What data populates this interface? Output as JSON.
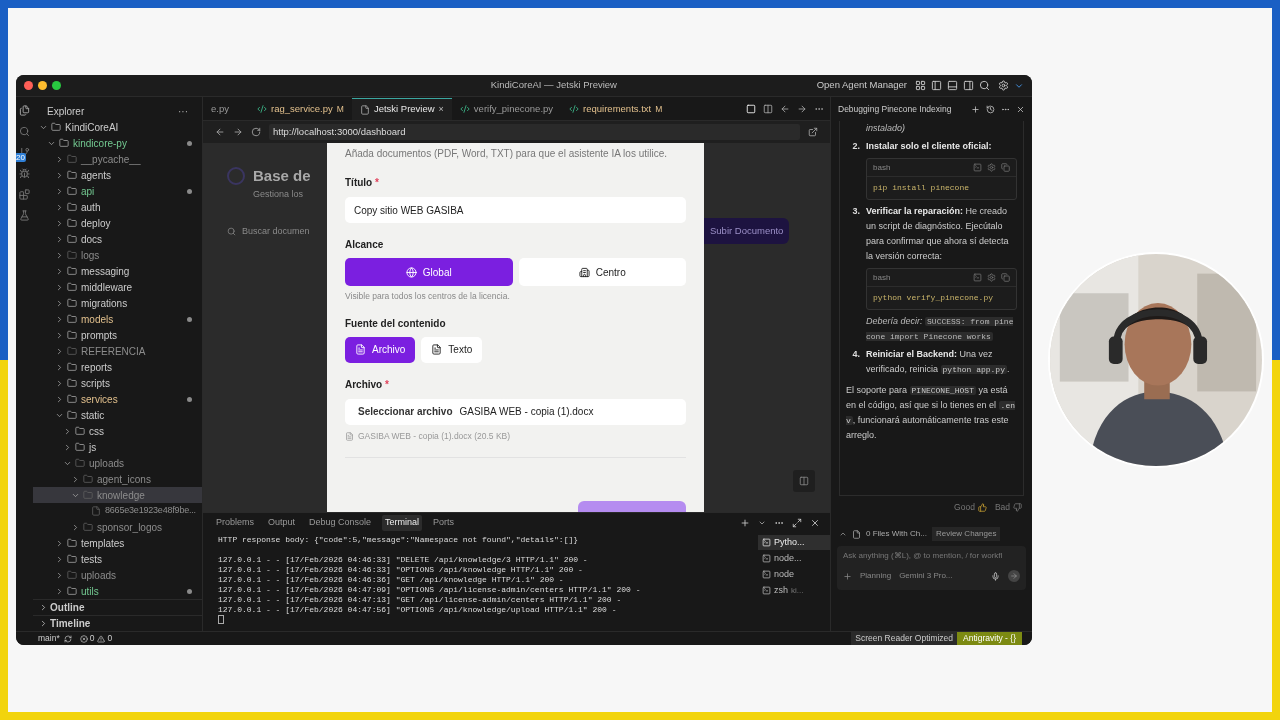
{
  "window": {
    "title": "KindiCoreAI — Jetski Preview",
    "agent_manager": "Open Agent Manager",
    "activity_badge": "20"
  },
  "explorer": {
    "title": "Explorer",
    "menu": "···",
    "tree": [
      {
        "label": "KindiCoreAI",
        "kind": "folder",
        "expanded": true,
        "untracked": false,
        "modified": false,
        "ignored": false,
        "selected": false,
        "children": [
          {
            "label": "kindicore-py",
            "kind": "folder",
            "expanded": true,
            "untracked": true,
            "modified": true,
            "ignored": false,
            "selected": false,
            "children": [
              {
                "label": "__pycache__",
                "kind": "folder",
                "expanded": false,
                "untracked": false,
                "modified": false,
                "ignored": true,
                "selected": false
              },
              {
                "label": "agents",
                "kind": "folder",
                "expanded": false,
                "untracked": false,
                "modified": false,
                "ignored": false,
                "selected": false
              },
              {
                "label": "api",
                "kind": "folder",
                "expanded": false,
                "untracked": true,
                "modified": true,
                "ignored": false,
                "selected": false
              },
              {
                "label": "auth",
                "kind": "folder",
                "expanded": false,
                "untracked": false,
                "modified": false,
                "ignored": false,
                "selected": false
              },
              {
                "label": "deploy",
                "kind": "folder",
                "expanded": false,
                "untracked": false,
                "modified": false,
                "ignored": false,
                "selected": false
              },
              {
                "label": "docs",
                "kind": "folder",
                "expanded": false,
                "untracked": false,
                "modified": false,
                "ignored": false,
                "selected": false
              },
              {
                "label": "logs",
                "kind": "folder",
                "expanded": false,
                "untracked": false,
                "modified": false,
                "ignored": true,
                "selected": false
              },
              {
                "label": "messaging",
                "kind": "folder",
                "expanded": false,
                "untracked": false,
                "modified": false,
                "ignored": false,
                "selected": false
              },
              {
                "label": "middleware",
                "kind": "folder",
                "expanded": false,
                "untracked": false,
                "modified": false,
                "ignored": false,
                "selected": false
              },
              {
                "label": "migrations",
                "kind": "folder",
                "expanded": false,
                "untracked": false,
                "modified": false,
                "ignored": false,
                "selected": false
              },
              {
                "label": "models",
                "kind": "folder",
                "expanded": false,
                "untracked": false,
                "modified": true,
                "ignored": false,
                "selected": false
              },
              {
                "label": "prompts",
                "kind": "folder",
                "expanded": false,
                "untracked": false,
                "modified": false,
                "ignored": false,
                "selected": false
              },
              {
                "label": "REFERENCIA",
                "kind": "folder",
                "expanded": false,
                "untracked": false,
                "modified": false,
                "ignored": true,
                "selected": false
              },
              {
                "label": "reports",
                "kind": "folder",
                "expanded": false,
                "untracked": false,
                "modified": false,
                "ignored": false,
                "selected": false
              },
              {
                "label": "scripts",
                "kind": "folder",
                "expanded": false,
                "untracked": false,
                "modified": false,
                "ignored": false,
                "selected": false
              },
              {
                "label": "services",
                "kind": "folder",
                "expanded": false,
                "untracked": false,
                "modified": true,
                "ignored": false,
                "selected": false
              },
              {
                "label": "static",
                "kind": "folder",
                "expanded": true,
                "untracked": false,
                "modified": false,
                "ignored": false,
                "selected": false,
                "children": [
                  {
                    "label": "css",
                    "kind": "folder",
                    "expanded": false,
                    "untracked": false,
                    "modified": false,
                    "ignored": false,
                    "selected": false
                  },
                  {
                    "label": "js",
                    "kind": "folder",
                    "expanded": false,
                    "untracked": false,
                    "modified": false,
                    "ignored": false,
                    "selected": false
                  },
                  {
                    "label": "uploads",
                    "kind": "folder",
                    "expanded": true,
                    "untracked": false,
                    "modified": false,
                    "ignored": true,
                    "selected": false,
                    "children": [
                      {
                        "label": "agent_icons",
                        "kind": "folder",
                        "expanded": false,
                        "untracked": false,
                        "modified": false,
                        "ignored": true,
                        "selected": false
                      },
                      {
                        "label": "knowledge",
                        "kind": "folder",
                        "expanded": true,
                        "untracked": false,
                        "modified": false,
                        "ignored": true,
                        "selected": true,
                        "children": [
                          {
                            "label": "8665e3e1923e48f9be...",
                            "kind": "file",
                            "untracked": false,
                            "modified": false,
                            "ignored": true,
                            "selected": false
                          }
                        ]
                      },
                      {
                        "label": "sponsor_logos",
                        "kind": "folder",
                        "expanded": false,
                        "untracked": false,
                        "modified": false,
                        "ignored": true,
                        "selected": false
                      }
                    ]
                  }
                ]
              },
              {
                "label": "templates",
                "kind": "folder",
                "expanded": false,
                "untracked": false,
                "modified": false,
                "ignored": false,
                "selected": false
              },
              {
                "label": "tests",
                "kind": "folder",
                "expanded": false,
                "untracked": false,
                "modified": false,
                "ignored": false,
                "selected": false
              },
              {
                "label": "uploads",
                "kind": "folder",
                "expanded": false,
                "untracked": false,
                "modified": false,
                "ignored": true,
                "selected": false
              },
              {
                "label": "utils",
                "kind": "folder",
                "expanded": false,
                "untracked": true,
                "modified": true,
                "ignored": false,
                "selected": false
              }
            ]
          }
        ]
      }
    ],
    "sections": [
      "Outline",
      "Timeline"
    ]
  },
  "editor_tabs": [
    {
      "label": "e.py",
      "kind": "plain",
      "selected": false
    },
    {
      "label": "rag_service.py",
      "status": "M",
      "kind": "python",
      "selected": false
    },
    {
      "label": "Jetski Preview",
      "close": "×",
      "kind": "page",
      "selected": true
    },
    {
      "label": "verify_pinecone.py",
      "kind": "python",
      "selected": false
    },
    {
      "label": "requirements.txt",
      "status": "M",
      "kind": "python",
      "selected": false
    }
  ],
  "browser": {
    "url": "http://localhost:3000/dashboard"
  },
  "page": {
    "heading": "Base de",
    "subtitle": "Gestiona los",
    "search_placeholder": "Buscar documen",
    "upload_button": "Subir Documento"
  },
  "modal": {
    "description": "Añada documentos (PDF, Word, TXT) para que el asistente IA los utilice.",
    "title_label": "Título",
    "required_mark": "*",
    "title_value": "Copy sitio WEB GASIBA",
    "scope_label": "Alcance",
    "scope_options": [
      {
        "label": "Global",
        "kind": "globe",
        "selected": true
      },
      {
        "label": "Centro",
        "kind": "building",
        "selected": false
      }
    ],
    "scope_hint": "Visible para todos los centros de la licencia.",
    "source_label": "Fuente del contenido",
    "source_options": [
      {
        "label": "Archivo",
        "kind": "file",
        "selected": true
      },
      {
        "label": "Texto",
        "kind": "file",
        "selected": false
      }
    ],
    "file_label": "Archivo",
    "file_required_mark": "*",
    "file_button": "Seleccionar archivo",
    "file_name": "GASIBA WEB - copia (1).docx",
    "file_info": "GASIBA WEB - copia (1).docx (20.5 KB)"
  },
  "panel": {
    "tabs": [
      {
        "label": "Problems",
        "selected": false
      },
      {
        "label": "Output",
        "selected": false
      },
      {
        "label": "Debug Console",
        "selected": false
      },
      {
        "label": "Terminal",
        "selected": true
      },
      {
        "label": "Ports",
        "selected": false
      }
    ],
    "lines": [
      "HTTP response body: {\"code\":5,\"message\":\"Namespace not found\",\"details\":[]}",
      "127.0.0.1 - - [17/Feb/2026 04:46:33] \"DELETE /api/knowledge/3 HTTP/1.1\" 200 -",
      "127.0.0.1 - - [17/Feb/2026 04:46:33] \"OPTIONS /api/knowledge HTTP/1.1\" 200 -",
      "127.0.0.1 - - [17/Feb/2026 04:46:36] \"GET /api/knowledge HTTP/1.1\" 200 -",
      "127.0.0.1 - - [17/Feb/2026 04:47:09] \"OPTIONS /api/license-admin/centers HTTP/1.1\" 200 -",
      "127.0.0.1 - - [17/Feb/2026 04:47:13] \"GET /api/license-admin/centers HTTP/1.1\" 200 -",
      "127.0.0.1 - - [17/Feb/2026 04:47:56] \"OPTIONS /api/knowledge/upload HTTP/1.1\" 200 -"
    ],
    "sessions": [
      {
        "label": "Pytho...",
        "selected": true
      },
      {
        "label": "node...",
        "selected": false
      },
      {
        "label": "node",
        "selected": false
      },
      {
        "label": "zsh",
        "extra": "ki...",
        "selected": false
      }
    ]
  },
  "agent": {
    "title": "Debugging Pinecone Indexing",
    "blocks": [
      {
        "kind": "note",
        "segments": [
          {
            "kind": "italic",
            "text": "instalado)"
          }
        ]
      },
      {
        "kind": "step",
        "number": "2.",
        "segments": [
          {
            "kind": "bold",
            "text": "Instalar solo el cliente oficial:"
          }
        ]
      },
      {
        "kind": "code",
        "lang": "bash",
        "code": "pip install pinecone"
      },
      {
        "kind": "step",
        "number": "3.",
        "segments": [
          {
            "kind": "bold",
            "text": "Verificar la reparación:"
          },
          {
            "kind": "text",
            "text": " He creado un script de diagnóstico. Ejecútalo para confirmar que ahora sí detecta la versión correcta:"
          }
        ]
      },
      {
        "kind": "code",
        "lang": "bash",
        "code": "python verify_pinecone.py"
      },
      {
        "kind": "note",
        "segments": [
          {
            "kind": "italic",
            "text": "Debería decir: "
          },
          {
            "kind": "code",
            "text": "SUCCESS: from pinecone import Pinecone works"
          }
        ]
      },
      {
        "kind": "step",
        "number": "4.",
        "segments": [
          {
            "kind": "bold",
            "text": "Reiniciar el Backend:"
          },
          {
            "kind": "text",
            "text": " Una vez verificado, reinicia "
          },
          {
            "kind": "code",
            "text": "python app.py"
          },
          {
            "kind": "text",
            "text": "."
          }
        ]
      },
      {
        "kind": "paragraph",
        "segments": [
          {
            "kind": "text",
            "text": "El soporte para "
          },
          {
            "kind": "code",
            "text": "PINECONE_HOST"
          },
          {
            "kind": "text",
            "text": " ya está en el código, así que si lo tienes en el "
          },
          {
            "kind": "code",
            "text": ".env"
          },
          {
            "kind": "text",
            "text": ", funcionará automáticamente tras este arreglo."
          }
        ]
      }
    ],
    "feedback": [
      "Good",
      "Bad"
    ],
    "files_changed": "0 Files With Ch...",
    "review": "Review Changes",
    "input_placeholder": "Ask anything (⌘L), @ to mention, / for workfl",
    "mode": "Planning",
    "model": "Gemini 3 Pro..."
  },
  "status_bar": {
    "branch": "main*",
    "errors": "0",
    "warnings": "0",
    "screen_reader": "Screen Reader Optimized",
    "brand": "Antigravity - {}"
  }
}
